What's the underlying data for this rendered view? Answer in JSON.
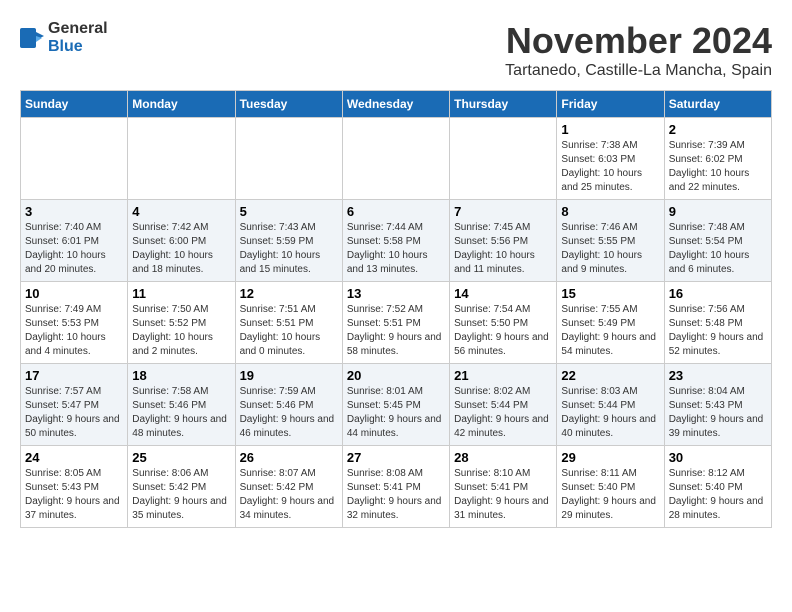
{
  "header": {
    "logo_general": "General",
    "logo_blue": "Blue",
    "month_year": "November 2024",
    "location": "Tartanedo, Castille-La Mancha, Spain"
  },
  "weekdays": [
    "Sunday",
    "Monday",
    "Tuesday",
    "Wednesday",
    "Thursday",
    "Friday",
    "Saturday"
  ],
  "weeks": [
    [
      {
        "day": "",
        "info": ""
      },
      {
        "day": "",
        "info": ""
      },
      {
        "day": "",
        "info": ""
      },
      {
        "day": "",
        "info": ""
      },
      {
        "day": "",
        "info": ""
      },
      {
        "day": "1",
        "info": "Sunrise: 7:38 AM\nSunset: 6:03 PM\nDaylight: 10 hours and 25 minutes."
      },
      {
        "day": "2",
        "info": "Sunrise: 7:39 AM\nSunset: 6:02 PM\nDaylight: 10 hours and 22 minutes."
      }
    ],
    [
      {
        "day": "3",
        "info": "Sunrise: 7:40 AM\nSunset: 6:01 PM\nDaylight: 10 hours and 20 minutes."
      },
      {
        "day": "4",
        "info": "Sunrise: 7:42 AM\nSunset: 6:00 PM\nDaylight: 10 hours and 18 minutes."
      },
      {
        "day": "5",
        "info": "Sunrise: 7:43 AM\nSunset: 5:59 PM\nDaylight: 10 hours and 15 minutes."
      },
      {
        "day": "6",
        "info": "Sunrise: 7:44 AM\nSunset: 5:58 PM\nDaylight: 10 hours and 13 minutes."
      },
      {
        "day": "7",
        "info": "Sunrise: 7:45 AM\nSunset: 5:56 PM\nDaylight: 10 hours and 11 minutes."
      },
      {
        "day": "8",
        "info": "Sunrise: 7:46 AM\nSunset: 5:55 PM\nDaylight: 10 hours and 9 minutes."
      },
      {
        "day": "9",
        "info": "Sunrise: 7:48 AM\nSunset: 5:54 PM\nDaylight: 10 hours and 6 minutes."
      }
    ],
    [
      {
        "day": "10",
        "info": "Sunrise: 7:49 AM\nSunset: 5:53 PM\nDaylight: 10 hours and 4 minutes."
      },
      {
        "day": "11",
        "info": "Sunrise: 7:50 AM\nSunset: 5:52 PM\nDaylight: 10 hours and 2 minutes."
      },
      {
        "day": "12",
        "info": "Sunrise: 7:51 AM\nSunset: 5:51 PM\nDaylight: 10 hours and 0 minutes."
      },
      {
        "day": "13",
        "info": "Sunrise: 7:52 AM\nSunset: 5:51 PM\nDaylight: 9 hours and 58 minutes."
      },
      {
        "day": "14",
        "info": "Sunrise: 7:54 AM\nSunset: 5:50 PM\nDaylight: 9 hours and 56 minutes."
      },
      {
        "day": "15",
        "info": "Sunrise: 7:55 AM\nSunset: 5:49 PM\nDaylight: 9 hours and 54 minutes."
      },
      {
        "day": "16",
        "info": "Sunrise: 7:56 AM\nSunset: 5:48 PM\nDaylight: 9 hours and 52 minutes."
      }
    ],
    [
      {
        "day": "17",
        "info": "Sunrise: 7:57 AM\nSunset: 5:47 PM\nDaylight: 9 hours and 50 minutes."
      },
      {
        "day": "18",
        "info": "Sunrise: 7:58 AM\nSunset: 5:46 PM\nDaylight: 9 hours and 48 minutes."
      },
      {
        "day": "19",
        "info": "Sunrise: 7:59 AM\nSunset: 5:46 PM\nDaylight: 9 hours and 46 minutes."
      },
      {
        "day": "20",
        "info": "Sunrise: 8:01 AM\nSunset: 5:45 PM\nDaylight: 9 hours and 44 minutes."
      },
      {
        "day": "21",
        "info": "Sunrise: 8:02 AM\nSunset: 5:44 PM\nDaylight: 9 hours and 42 minutes."
      },
      {
        "day": "22",
        "info": "Sunrise: 8:03 AM\nSunset: 5:44 PM\nDaylight: 9 hours and 40 minutes."
      },
      {
        "day": "23",
        "info": "Sunrise: 8:04 AM\nSunset: 5:43 PM\nDaylight: 9 hours and 39 minutes."
      }
    ],
    [
      {
        "day": "24",
        "info": "Sunrise: 8:05 AM\nSunset: 5:43 PM\nDaylight: 9 hours and 37 minutes."
      },
      {
        "day": "25",
        "info": "Sunrise: 8:06 AM\nSunset: 5:42 PM\nDaylight: 9 hours and 35 minutes."
      },
      {
        "day": "26",
        "info": "Sunrise: 8:07 AM\nSunset: 5:42 PM\nDaylight: 9 hours and 34 minutes."
      },
      {
        "day": "27",
        "info": "Sunrise: 8:08 AM\nSunset: 5:41 PM\nDaylight: 9 hours and 32 minutes."
      },
      {
        "day": "28",
        "info": "Sunrise: 8:10 AM\nSunset: 5:41 PM\nDaylight: 9 hours and 31 minutes."
      },
      {
        "day": "29",
        "info": "Sunrise: 8:11 AM\nSunset: 5:40 PM\nDaylight: 9 hours and 29 minutes."
      },
      {
        "day": "30",
        "info": "Sunrise: 8:12 AM\nSunset: 5:40 PM\nDaylight: 9 hours and 28 minutes."
      }
    ]
  ]
}
